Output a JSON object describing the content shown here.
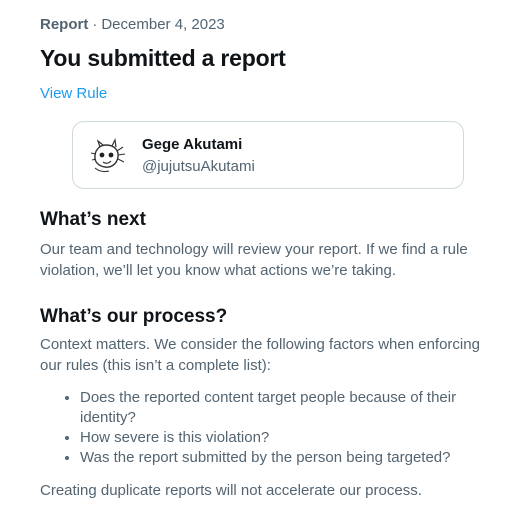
{
  "header": {
    "kind": "Report",
    "separator": "·",
    "date": "December 4, 2023",
    "title": "You submitted a report",
    "view_rule_link": "View Rule"
  },
  "reported_account": {
    "display_name": "Gege Akutami",
    "handle": "@jujutsuAkutami",
    "avatar_icon": "sketch-avatar-icon"
  },
  "whats_next": {
    "heading": "What’s next",
    "body": "Our team and technology will review your report. If we find a rule violation, we’ll let you know what actions we’re taking."
  },
  "process": {
    "heading": "What’s our process?",
    "intro": "Context matters. We consider the following factors when enforcing our rules (this isn’t a complete list):",
    "factors": [
      "Does the reported content target people because of their identity?",
      "How severe is this violation?",
      "Was the report submitted by the person being targeted?"
    ],
    "note": "Creating duplicate reports will not accelerate our process."
  },
  "colors": {
    "text": "#0f1419",
    "secondary": "#536471",
    "link": "#1d9bf0",
    "border": "#cfd9de"
  }
}
